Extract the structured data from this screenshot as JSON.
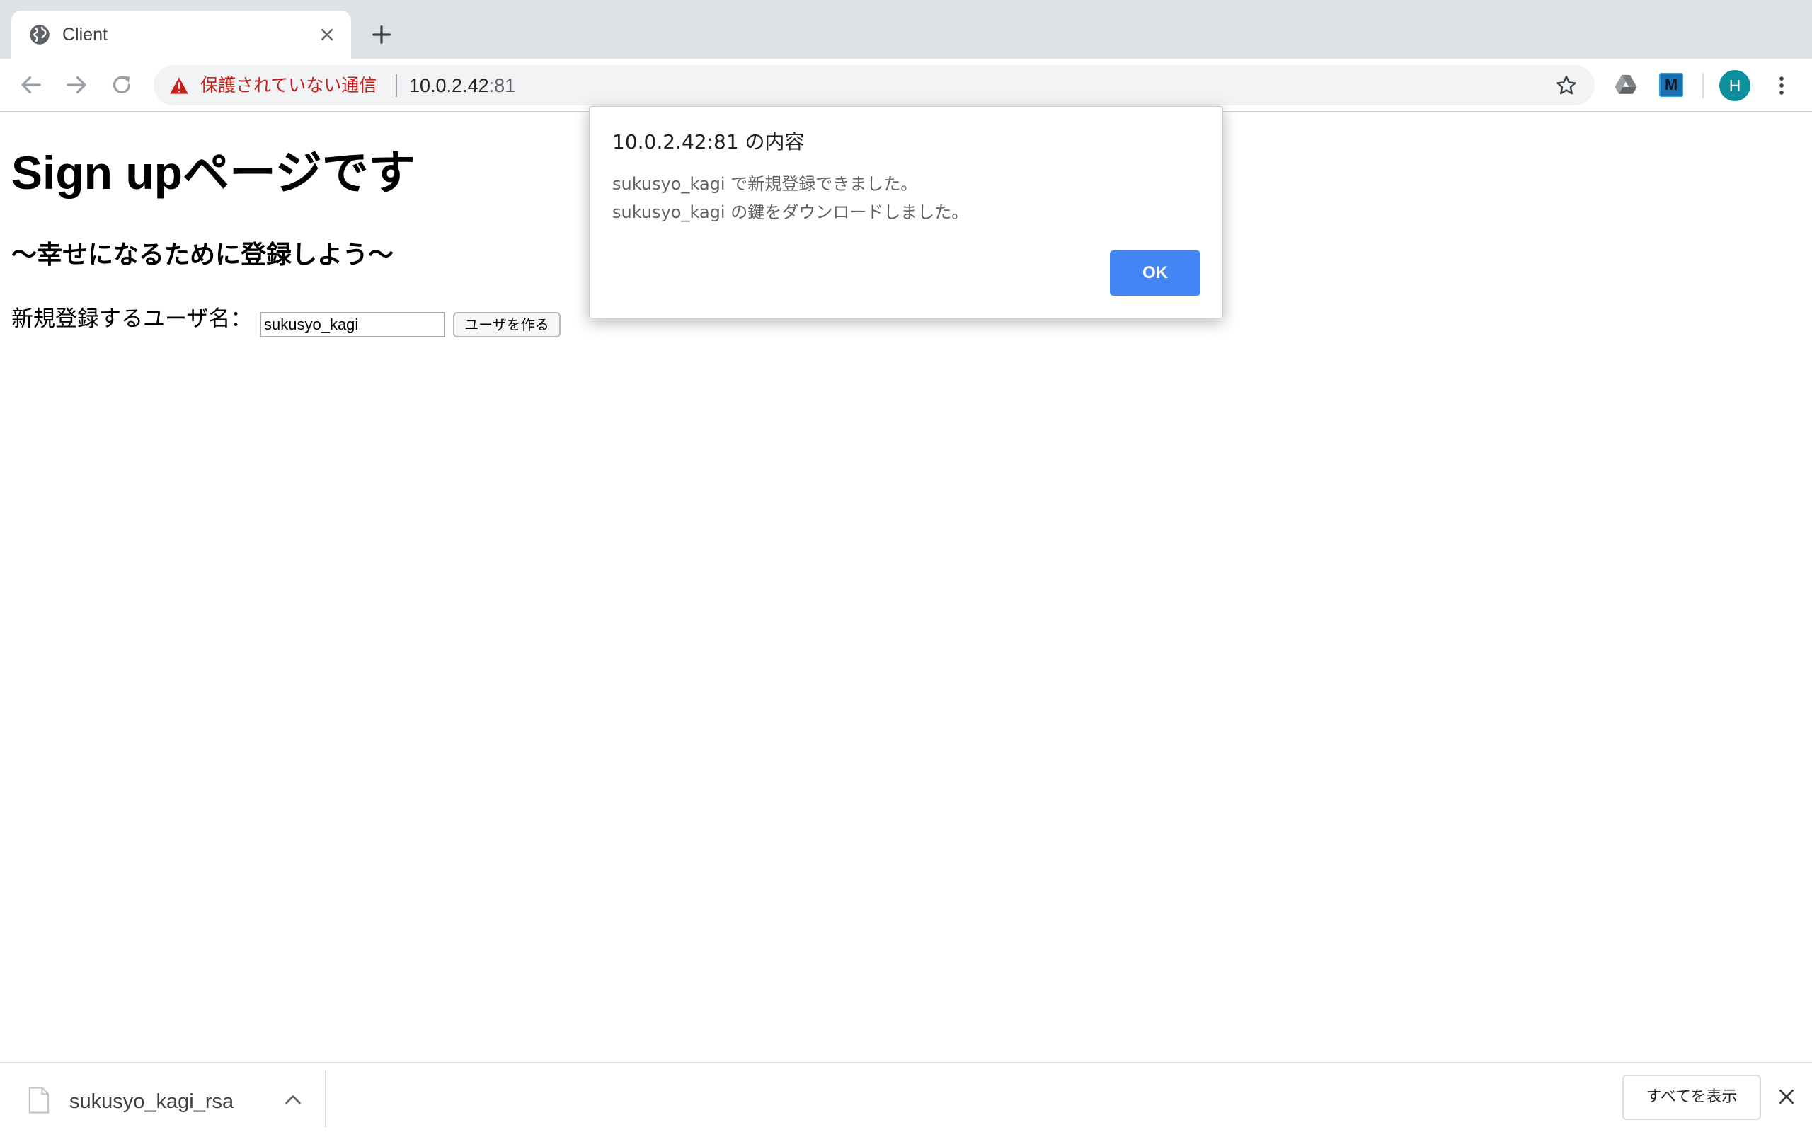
{
  "browser": {
    "tab": {
      "title": "Client",
      "favicon": "globe-icon"
    },
    "new_tab_icon": "plus-icon",
    "nav": {
      "back_icon": "arrow-back-icon",
      "forward_icon": "arrow-forward-icon",
      "reload_icon": "reload-icon"
    },
    "omnibox": {
      "security_icon": "warning-icon",
      "security_text": "保護されていない通信",
      "url_host": "10.0.2.42",
      "url_port": ":81",
      "bookmark_icon": "star-icon"
    },
    "extensions": [
      {
        "name": "drive-icon"
      },
      {
        "name": "m-extension-icon",
        "label": "M"
      }
    ],
    "profile_initial": "H",
    "menu_icon": "kebab-menu-icon"
  },
  "page": {
    "heading": "Sign upページです",
    "subheading": "〜幸せになるために登録しよう〜",
    "form": {
      "label": "新規登録するユーザ名：",
      "input_value": "sukusyo_kagi",
      "button_label": "ユーザを作る"
    }
  },
  "dialog": {
    "title": "10.0.2.42:81 の内容",
    "message_line1": "sukusyo_kagi で新規登録できました。",
    "message_line2": "sukusyo_kagi の鍵をダウンロードしました。",
    "ok_label": "OK"
  },
  "download_shelf": {
    "file_name": "sukusyo_kagi_rsa",
    "show_all_label": "すべてを表示"
  },
  "colors": {
    "accent": "#4285f4",
    "warning": "#c5221f",
    "avatar": "#0e8f9c",
    "tabstrip": "#dee1e6"
  }
}
